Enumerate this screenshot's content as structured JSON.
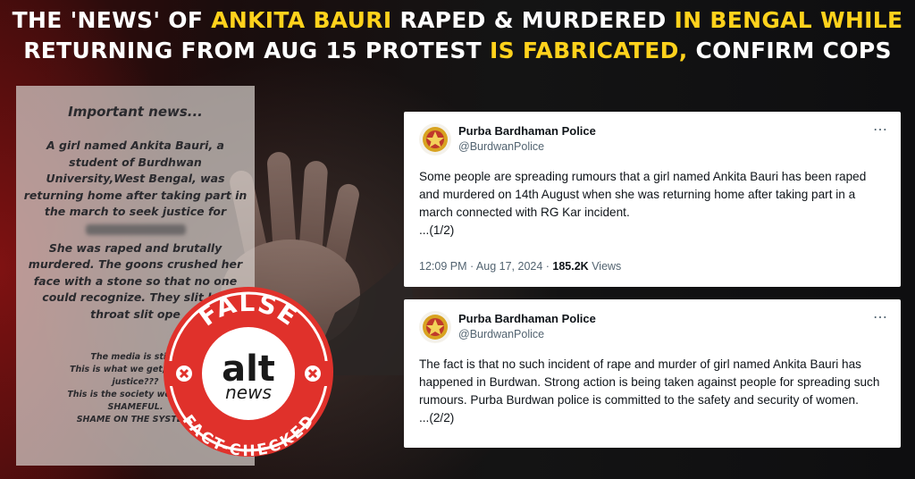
{
  "headline": {
    "line1_a": "THE 'NEWS' OF ",
    "line1_b": "ANKITA BAURI",
    "line1_c": " RAPED & MURDERED ",
    "line1_d": "IN BENGAL WHILE",
    "line2_a": "RETURNING FROM AUG 15 PROTEST ",
    "line2_b": "IS FABRICATED,",
    "line2_c": " CONFIRM COPS"
  },
  "colors": {
    "highlight": "#ffd21c",
    "seal_red": "#e0312b",
    "muted_text": "#536471"
  },
  "social_post": {
    "title": "Important news...",
    "body": "A girl named Ankita Bauri, a student of Burdhwan University,West Bengal, was returning home after taking part in the march to seek justice for",
    "body2": "She was raped and brutally murdered. The goons crushed her face with a stone so that no one could recognize. They slit her throat slit ope",
    "footer_1": "The media is still s",
    "footer_2": "This is what we get, as a re",
    "footer_3": "justice???",
    "footer_4": "This is the society we are liv",
    "footer_5": "SHAMEFUL.",
    "footer_6": "SHAME ON THE SYSTEM."
  },
  "seal": {
    "top_text": "FALSE",
    "brand_top": "alt",
    "brand_bottom": "news",
    "bottom_text": "FACT-CHECKED"
  },
  "tweets": [
    {
      "name": "Purba Bardhaman Police",
      "handle": "@BurdwanPolice",
      "more_icon": "⋯",
      "text": "Some people are spreading rumours that a girl named Ankita Bauri has been raped and murdered on 14th August when she was returning home after taking part in a march connected with RG Kar incident.\n...(1/2)",
      "time": "12:09 PM · Aug 17, 2024 · ",
      "views_count": "185.2K",
      "views_label": " Views"
    },
    {
      "name": "Purba Bardhaman Police",
      "handle": "@BurdwanPolice",
      "more_icon": "⋯",
      "text": "The fact is that no such incident of rape and murder of girl named Ankita Bauri has happened in Burdwan. Strong action is being taken against people for spreading such rumours. Purba Burdwan police is committed to the safety and security of women.\n...(2/2)"
    }
  ]
}
